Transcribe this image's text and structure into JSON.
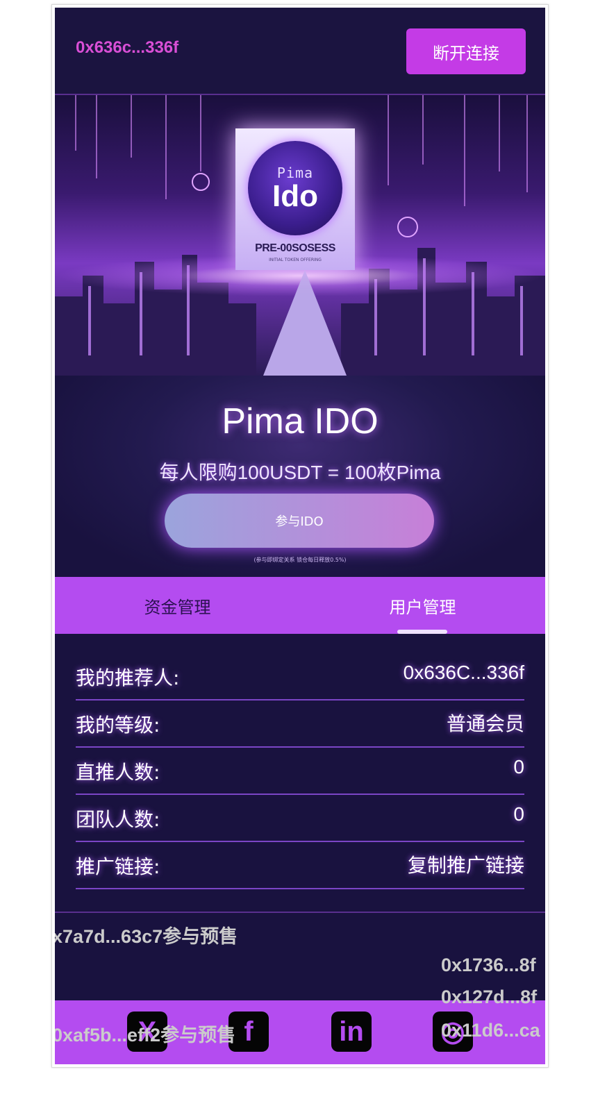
{
  "header": {
    "address": "0x636c...336f",
    "disconnect_label": "断开连接"
  },
  "banner": {
    "sign_top": "Pima",
    "sign_main": "Ido",
    "sign_caption": "PRE-00SOSESS",
    "sign_subcaption": "INITIAL TOKEN OFFERING"
  },
  "ido": {
    "title": "Pima IDO",
    "subtitle": "每人限购100USDT = 100枚Pima",
    "join_label": "参与IDO",
    "note": "(参与即绑定关系 锁仓每日释放0.5%)"
  },
  "tabs": [
    {
      "label": "资金管理"
    },
    {
      "label": "用户管理"
    }
  ],
  "info": [
    {
      "key": "我的推荐人:",
      "value": "0x636C...336f"
    },
    {
      "key": "我的等级:",
      "value": "普通会员"
    },
    {
      "key": "直推人数:",
      "value": "0"
    },
    {
      "key": "团队人数:",
      "value": "0"
    },
    {
      "key": "推广链接:",
      "value": "复制推广链接"
    }
  ],
  "ticker": [
    "x7a7d...63c7参与预售",
    "0x1736...8f",
    "0x127d...8f",
    "0xaf5b...eff2参与预售",
    "0x11d6...ca"
  ],
  "footer": {
    "icons": [
      "x-twitter-icon",
      "facebook-icon",
      "linkedin-icon",
      "instagram-icon"
    ],
    "icon_glyphs": [
      "X",
      "f",
      "in",
      "◎"
    ]
  },
  "colors": {
    "accent": "#b44cf0",
    "background": "#19123f",
    "address": "#d94fd6"
  }
}
